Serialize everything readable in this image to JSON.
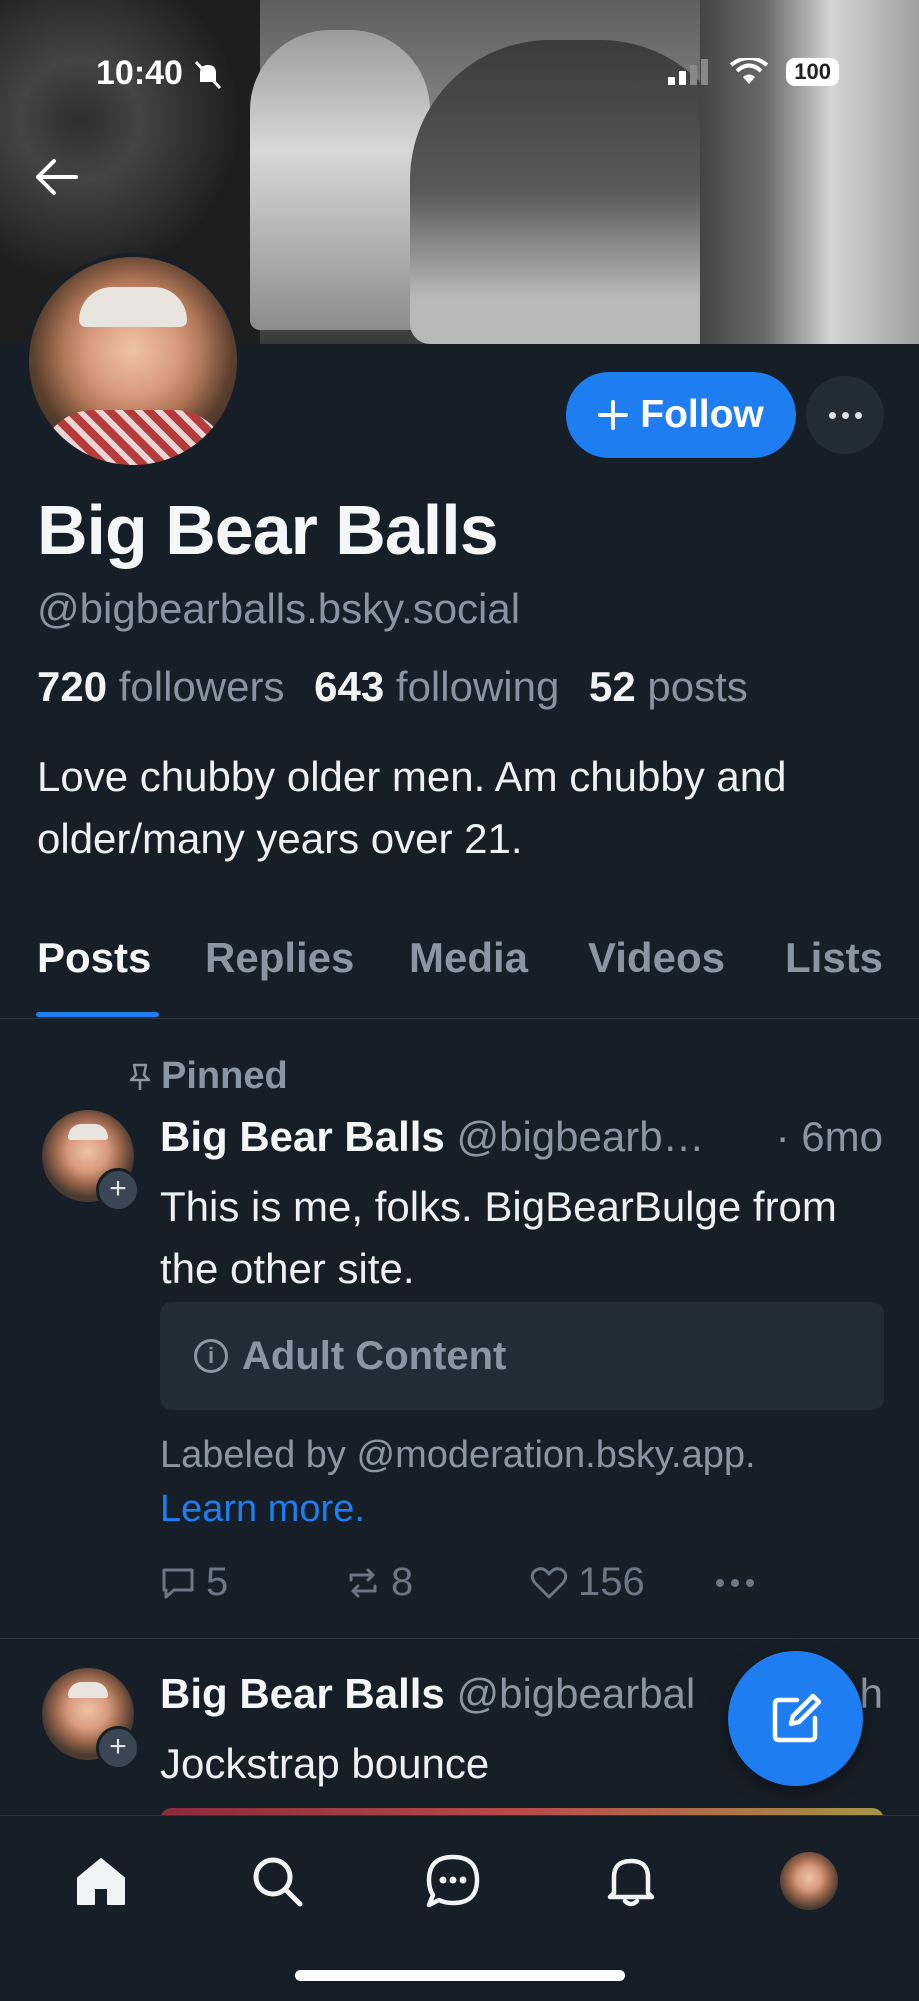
{
  "status_bar": {
    "time": "10:40",
    "battery": "100"
  },
  "profile": {
    "display_name": "Big Bear Balls",
    "handle": "@bigbearballs.bsky.social",
    "followers_count": "720",
    "followers_label": "followers",
    "following_count": "643",
    "following_label": "following",
    "posts_count": "52",
    "posts_label": "posts",
    "bio": "Love chubby older men. Am chubby and older/many years over 21.",
    "follow_label": "Follow"
  },
  "tabs": [
    {
      "label": "Posts",
      "active": true
    },
    {
      "label": "Replies",
      "active": false
    },
    {
      "label": "Media",
      "active": false
    },
    {
      "label": "Videos",
      "active": false
    },
    {
      "label": "Lists",
      "active": false
    }
  ],
  "posts": [
    {
      "pinned_label": "Pinned",
      "author": "Big Bear Balls",
      "handle": "@bigbearb…",
      "time": "· 6mo",
      "text": "This is me, folks. BigBearBulge from the other site.",
      "content_warning": "Adult Content",
      "labeled_by": "Labeled by @moderation.bsky.app.",
      "learn_more": "Learn more.",
      "replies": "5",
      "reposts": "8",
      "likes": "156"
    },
    {
      "author": "Big Bear Balls",
      "handle": "@bigbearbal",
      "time": "h",
      "text": "Jockstrap bounce"
    }
  ],
  "colors": {
    "background": "#161e27",
    "accent": "#1e7ef1",
    "muted_text": "#8a96a4",
    "card": "#222c37"
  },
  "icons": {
    "back": "arrow-left-icon",
    "follow_plus": "plus-icon",
    "more": "ellipsis-icon",
    "pin": "pin-icon",
    "info": "info-icon",
    "reply": "speech-bubble-icon",
    "repost": "repost-icon",
    "like": "heart-icon",
    "compose": "compose-icon",
    "nav": [
      "home-icon",
      "search-icon",
      "chat-icon",
      "bell-icon",
      "profile-avatar"
    ]
  }
}
